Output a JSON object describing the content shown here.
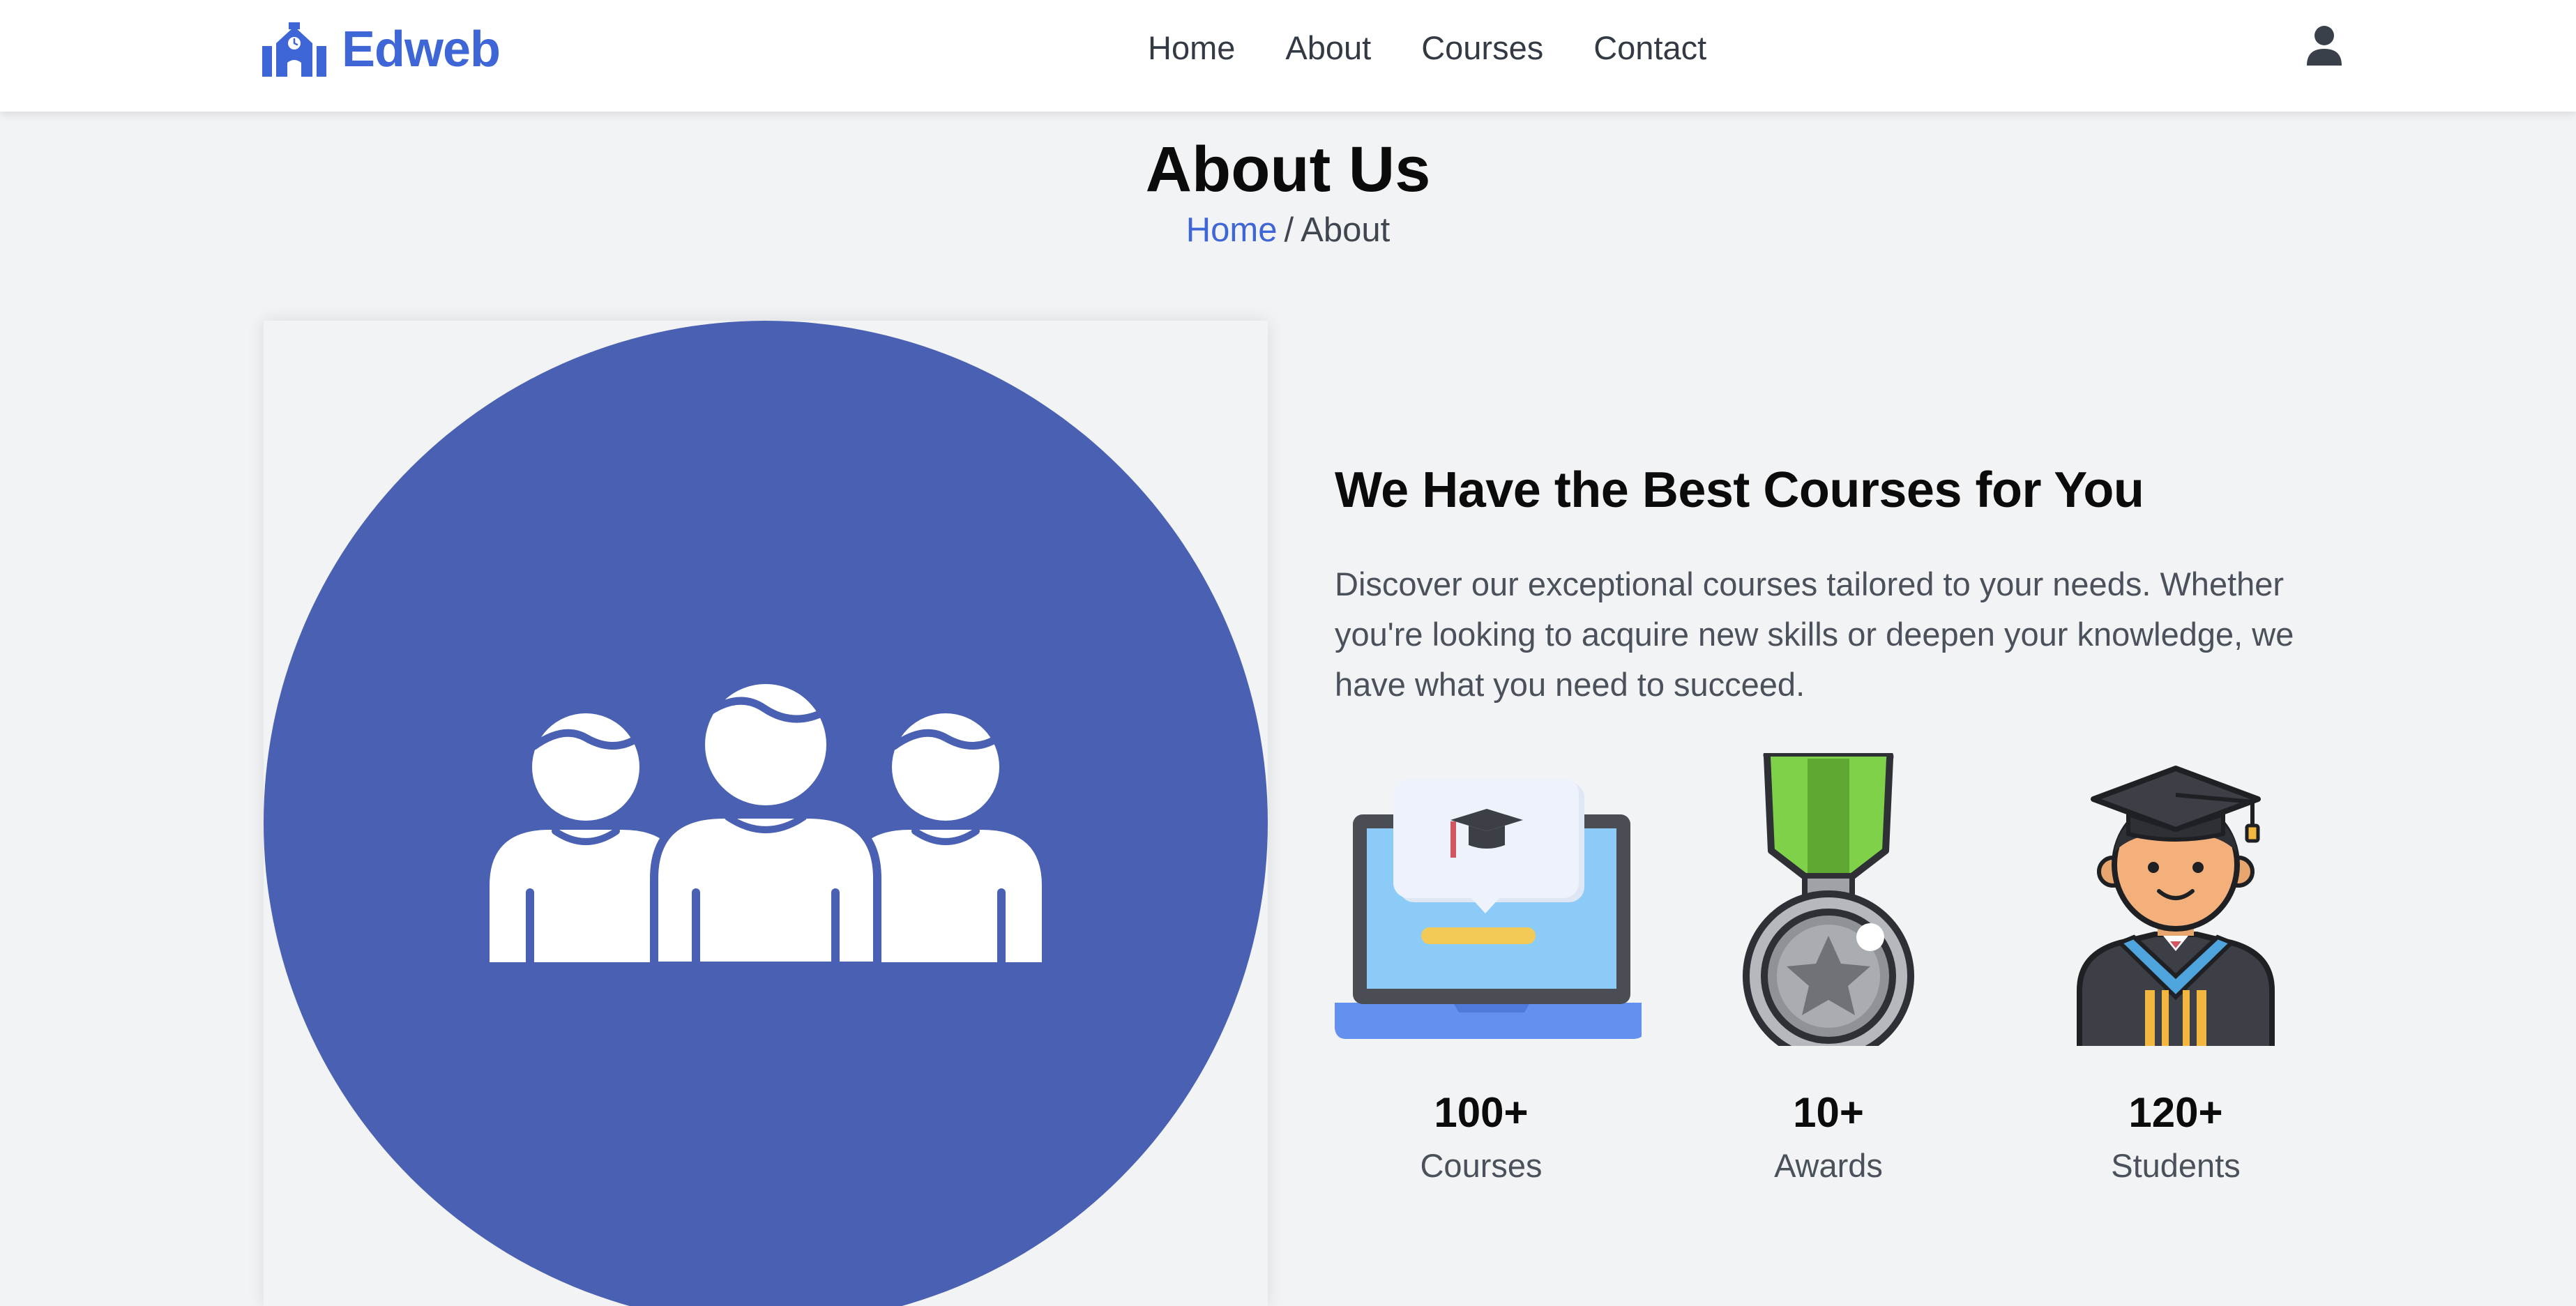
{
  "header": {
    "brand": "Edweb",
    "brand_icon": "school-building-icon",
    "nav": [
      {
        "label": "Home"
      },
      {
        "label": "About"
      },
      {
        "label": "Courses"
      },
      {
        "label": "Contact"
      }
    ],
    "user_icon": "user-icon"
  },
  "page": {
    "title": "About Us",
    "breadcrumb": {
      "home": "Home",
      "separator": "/",
      "current": "About"
    }
  },
  "hero": {
    "illustration": "group-of-people-icon",
    "circle_color": "#4a61b3"
  },
  "about": {
    "heading": "We Have the Best Courses for You",
    "text": "Discover our exceptional courses tailored to your needs. Whether you're looking to acquire new skills or deepen your knowledge, we have what you need to succeed."
  },
  "stats": [
    {
      "value": "100+",
      "label": "Courses",
      "icon": "laptop-course-icon"
    },
    {
      "value": "10+",
      "label": "Awards",
      "icon": "medal-icon"
    },
    {
      "value": "120+",
      "label": "Students",
      "icon": "graduate-student-icon"
    }
  ],
  "colors": {
    "accent": "#3e66d6",
    "background": "#f2f3f5",
    "text": "#0b0b0b",
    "muted_text": "#4a515b"
  }
}
